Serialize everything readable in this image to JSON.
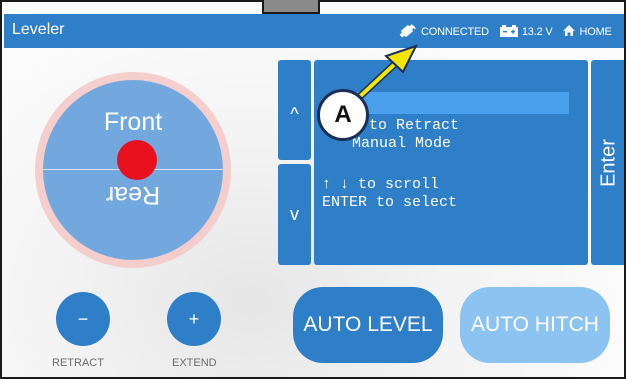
{
  "header": {
    "title": "Leveler",
    "connection_status": "CONNECTED",
    "battery_voltage": "13.2 V",
    "home_label": "HOME",
    "colors": {
      "bar": "#2f7ec8",
      "text": "#ffffff"
    }
  },
  "compass": {
    "front_label": "Front",
    "rear_label": "Rear"
  },
  "menu": {
    "up_arrow": "^",
    "down_arrow": "v",
    "lines": [
      "to Retract",
      "Manual Mode",
      "↑ ↓ to scroll",
      "ENTER to select"
    ],
    "enter_label": "Enter"
  },
  "jack_controls": {
    "retract_symbol": "−",
    "retract_label": "RETRACT",
    "extend_symbol": "+",
    "extend_label": "EXTEND"
  },
  "actions": {
    "auto_level_label": "AUTO LEVEL",
    "auto_hitch_label": "AUTO HITCH"
  },
  "annotation": {
    "callout_letter": "A",
    "arrow_color": "#f3e600"
  }
}
